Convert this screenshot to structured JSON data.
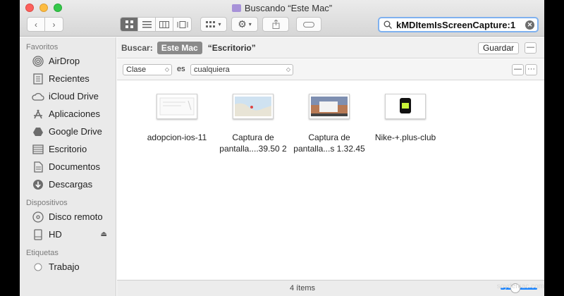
{
  "window": {
    "title": "Buscando “Este Mac”"
  },
  "toolbar": {
    "back_icon": "chevron-left-icon",
    "forward_icon": "chevron-right-icon",
    "view_icons": [
      "icon-view-icon",
      "list-view-icon",
      "column-view-icon",
      "gallery-view-icon"
    ],
    "arrange_icon": "grid-arrange-icon",
    "action_icon": "gear-icon",
    "share_icon": "share-icon",
    "tag_icon": "tag-icon"
  },
  "search": {
    "value": "kMDItemIsScreenCapture:1"
  },
  "sidebar": {
    "favorites_heading": "Favoritos",
    "favorites": [
      {
        "label": "AirDrop",
        "icon": "airdrop-icon"
      },
      {
        "label": "Recientes",
        "icon": "recents-icon"
      },
      {
        "label": "iCloud Drive",
        "icon": "cloud-icon"
      },
      {
        "label": "Aplicaciones",
        "icon": "applications-icon"
      },
      {
        "label": "Google Drive",
        "icon": "google-drive-icon"
      },
      {
        "label": "Escritorio",
        "icon": "desktop-icon"
      },
      {
        "label": "Documentos",
        "icon": "documents-icon"
      },
      {
        "label": "Descargas",
        "icon": "downloads-icon"
      }
    ],
    "devices_heading": "Dispositivos",
    "devices": [
      {
        "label": "Disco remoto",
        "icon": "disc-icon"
      },
      {
        "label": "HD",
        "icon": "hard-drive-icon"
      }
    ],
    "tags_heading": "Etiquetas",
    "tags": [
      {
        "label": "Trabajo",
        "icon": "tag-circle-icon"
      }
    ]
  },
  "scope": {
    "label": "Buscar:",
    "active": "Este Mac",
    "other": "“Escritorio”",
    "save_label": "Guardar",
    "minus": "—"
  },
  "criteria": {
    "attribute": "Clase",
    "operator": "es",
    "value": "cualquiera",
    "minus": "—",
    "more": "···"
  },
  "files": [
    {
      "name_line1": "adopcion-ios-11",
      "name_line2": ""
    },
    {
      "name_line1": "Captura de",
      "name_line2": "pantalla....39.50 2"
    },
    {
      "name_line1": "Captura de",
      "name_line2": "pantalla...s 1.32.45"
    },
    {
      "name_line1": "Nike-+.plus-club",
      "name_line2": ""
    }
  ],
  "status": {
    "count": "4 ítems"
  },
  "colors": {
    "accent": "#1e86ff",
    "selection_gray": "#8a8a8a"
  },
  "watermark": "soydemac.com"
}
